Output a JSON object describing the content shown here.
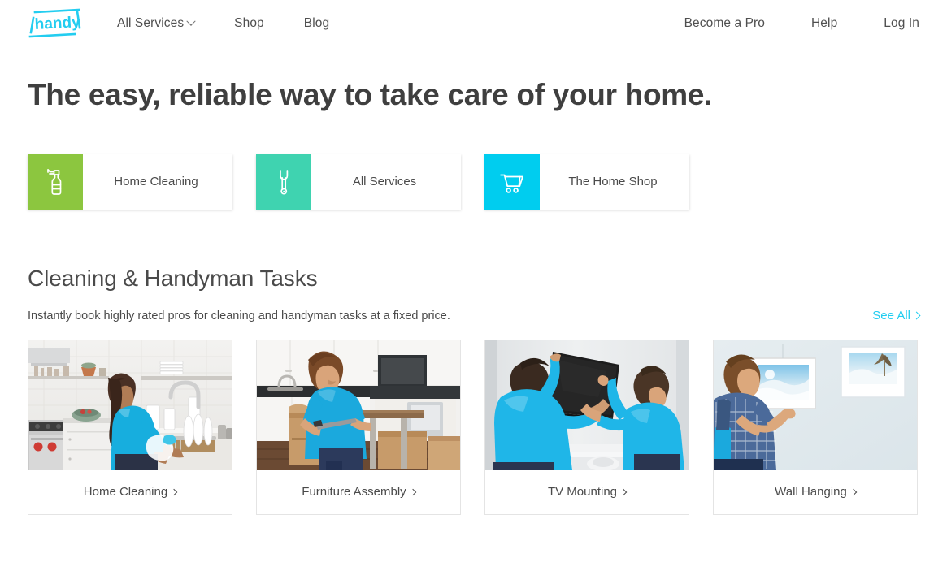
{
  "brand": {
    "logo_text": "handy",
    "logo_color": "#23cdf0"
  },
  "header": {
    "nav_left": [
      {
        "label": "All Services",
        "icon": "chevron-down-icon",
        "has_dropdown": true
      },
      {
        "label": "Shop",
        "has_dropdown": false
      },
      {
        "label": "Blog",
        "has_dropdown": false
      }
    ],
    "nav_right": [
      {
        "label": "Become a Pro"
      },
      {
        "label": "Help"
      },
      {
        "label": "Log In"
      }
    ]
  },
  "hero": {
    "headline": "The easy, reliable way to take care of your home."
  },
  "quick_tiles": [
    {
      "label": "Home Cleaning",
      "icon": "spray-bottle-icon",
      "color": "#8cc63f"
    },
    {
      "label": "All Services",
      "icon": "wrench-icon",
      "color": "#3fd3b0"
    },
    {
      "label": "The Home Shop",
      "icon": "shopping-cart-icon",
      "color": "#00cdef"
    }
  ],
  "section": {
    "title": "Cleaning & Handyman Tasks",
    "subtitle": "Instantly book highly rated pros for cleaning and handyman tasks at a fixed price.",
    "see_all_label": "See All",
    "see_all_icon": "chevron-right-icon",
    "see_all_color": "#21cdf0"
  },
  "task_cards": [
    {
      "label": "Home Cleaning",
      "icon": "chevron-right-icon",
      "image_alt": "Woman in blue polo washing dishes at a kitchen sink with a dish rack"
    },
    {
      "label": "Furniture Assembly",
      "icon": "chevron-right-icon",
      "image_alt": "Man in blue t-shirt assembling a table among cardboard moving boxes"
    },
    {
      "label": "TV Mounting",
      "icon": "chevron-right-icon",
      "image_alt": "Two men in cyan shirts mounting a flat screen TV above a fireplace"
    },
    {
      "label": "Wall Hanging",
      "icon": "chevron-right-icon",
      "image_alt": "Man in plaid shirt and blue overalls hanging a framed picture on a wall"
    }
  ]
}
